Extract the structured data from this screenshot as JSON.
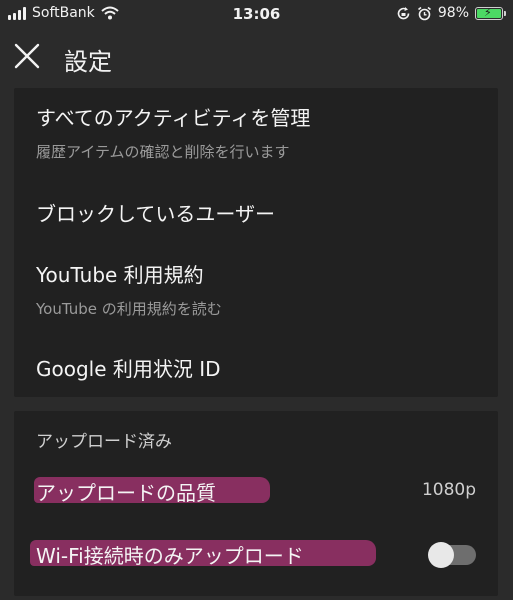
{
  "status_bar": {
    "carrier": "SoftBank",
    "time": "13:06",
    "battery": "98%",
    "battery_level": 0.98,
    "icons": [
      "signal-icon",
      "wifi-icon",
      "rotation-lock-icon",
      "alarm-icon",
      "battery-icon"
    ]
  },
  "header": {
    "title": "設定",
    "close_icon": "close-icon"
  },
  "history_section": {
    "items": [
      {
        "title": "すべてのアクティビティを管理",
        "subtitle": "履歴アイテムの確認と削除を行います"
      },
      {
        "title": "ブロックしているユーザー",
        "subtitle": ""
      },
      {
        "title": "YouTube 利用規約",
        "subtitle": "YouTube の利用規約を読む"
      },
      {
        "title": "Google 利用状況 ID",
        "subtitle": ""
      }
    ]
  },
  "uploads_section": {
    "label": "アップロード済み",
    "quality": {
      "label": "アップロードの品質",
      "value": "1080p"
    },
    "wifi_only": {
      "label": "Wi-Fi接続時のみアップロード",
      "enabled": false
    }
  },
  "colors": {
    "background": "#2b2b2b",
    "card": "#212121",
    "highlight": "#b03478",
    "battery_green": "#4cd964"
  }
}
